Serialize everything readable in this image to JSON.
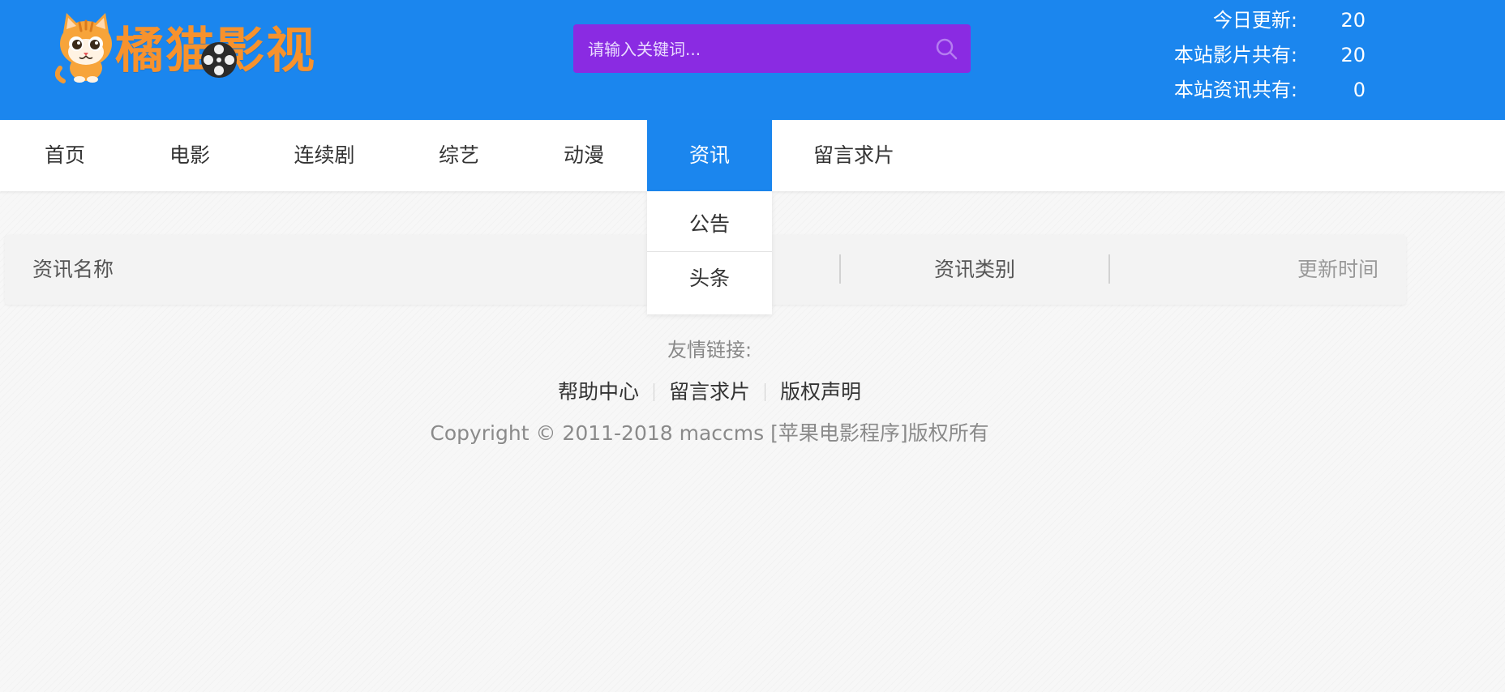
{
  "header": {
    "logo_text": "橘猫影视",
    "search": {
      "placeholder": "请输入关键词...",
      "value": ""
    },
    "stats": [
      {
        "label": "今日更新:",
        "value": "20"
      },
      {
        "label": "本站影片共有:",
        "value": "20"
      },
      {
        "label": "本站资讯共有:",
        "value": "0"
      }
    ]
  },
  "nav": {
    "items": [
      {
        "label": "首页"
      },
      {
        "label": "电影"
      },
      {
        "label": "连续剧"
      },
      {
        "label": "综艺"
      },
      {
        "label": "动漫"
      },
      {
        "label": "资讯"
      },
      {
        "label": "留言求片"
      }
    ],
    "active": "资讯",
    "dropdown": [
      {
        "label": "公告"
      },
      {
        "label": "头条"
      }
    ]
  },
  "table": {
    "columns": [
      "资讯名称",
      "资讯类别",
      "更新时间"
    ]
  },
  "footer": {
    "links_title": "友情链接:",
    "links": [
      "帮助中心",
      "留言求片",
      "版权声明"
    ],
    "copyright": "Copyright © 2011-2018 maccms [苹果电影程序]版权所有"
  },
  "colors": {
    "header_bg": "#1b86ee",
    "search_bg": "#8a2be2",
    "logo_orange": "#f7922d",
    "active_nav": "#1b86ee"
  },
  "icons": {
    "logo": "cat-mascot-icon",
    "search": "search-icon",
    "reel": "film-reel-icon"
  }
}
